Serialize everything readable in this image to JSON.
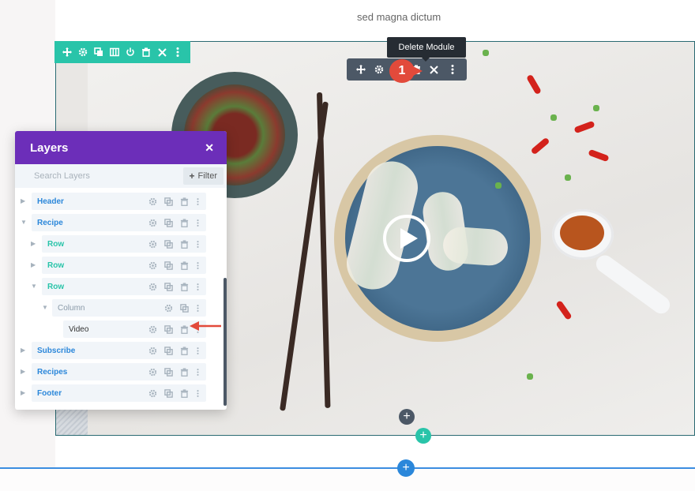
{
  "page": {
    "intro_text": "sed magna dictum"
  },
  "video_module": {
    "play_label": "Play video"
  },
  "tooltip": {
    "text": "Delete Module"
  },
  "callout": {
    "number": "1"
  },
  "section_toolbar": {
    "icons": [
      "move-icon",
      "gear-icon",
      "duplicate-icon",
      "columns-icon",
      "power-icon",
      "trash-icon",
      "close-icon",
      "more-icon"
    ]
  },
  "module_toolbar": {
    "icons": [
      "move-icon",
      "gear-icon",
      "duplicate-icon",
      "trash-icon",
      "close-icon",
      "more-icon"
    ]
  },
  "add_buttons": {
    "symbol": "+"
  },
  "layers_panel": {
    "title": "Layers",
    "close_symbol": "✕",
    "search_placeholder": "Search Layers",
    "filter_label": "Filter",
    "filter_symbol": "+",
    "items": [
      {
        "label": "Header",
        "type": "section",
        "depth": 0,
        "expanded": false
      },
      {
        "label": "Recipe",
        "type": "section",
        "depth": 0,
        "expanded": true
      },
      {
        "label": "Row",
        "type": "row",
        "depth": 1,
        "expanded": false
      },
      {
        "label": "Row",
        "type": "row",
        "depth": 1,
        "expanded": false
      },
      {
        "label": "Row",
        "type": "row",
        "depth": 1,
        "expanded": true
      },
      {
        "label": "Column",
        "type": "column",
        "depth": 2,
        "expanded": true
      },
      {
        "label": "Video",
        "type": "module",
        "depth": 3,
        "expanded": false
      },
      {
        "label": "Subscribe",
        "type": "section",
        "depth": 0,
        "expanded": false
      },
      {
        "label": "Recipes",
        "type": "section",
        "depth": 0,
        "expanded": false
      },
      {
        "label": "Footer",
        "type": "section",
        "depth": 0,
        "expanded": false
      }
    ]
  },
  "colors": {
    "section_accent": "#2b87da",
    "row_accent": "#29c4a9",
    "module_toolbar": "#4c5866",
    "layers_header": "#6c2eb9",
    "callout": "#e24a3b"
  }
}
